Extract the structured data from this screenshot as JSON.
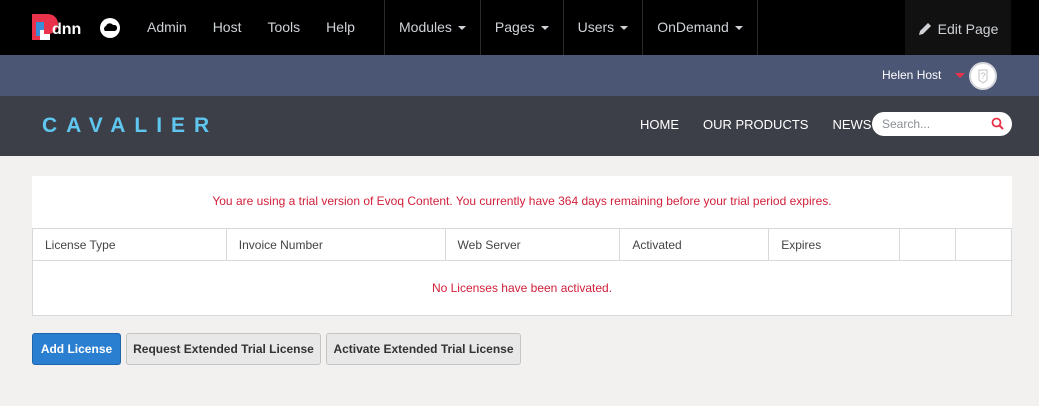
{
  "adminbar": {
    "logo_text": "dnn",
    "links": [
      "Admin",
      "Host",
      "Tools",
      "Help"
    ],
    "menus": [
      "Modules",
      "Pages",
      "Users",
      "OnDemand"
    ],
    "edit_page": "Edit Page"
  },
  "userbar": {
    "username": "Helen Host"
  },
  "site": {
    "brand": "CAVALIER",
    "nav": [
      "HOME",
      "OUR PRODUCTS",
      "NEWS"
    ],
    "search_placeholder": "Search..."
  },
  "license": {
    "trial_message": "You are using a trial version of Evoq Content. You currently have 364 days remaining before your trial period expires.",
    "columns": [
      "License Type",
      "Invoice Number",
      "Web Server",
      "Activated",
      "Expires",
      "",
      ""
    ],
    "empty_message": "No Licenses have been activated."
  },
  "buttons": {
    "add": "Add License",
    "request": "Request Extended Trial License",
    "activate": "Activate Extended Trial License"
  },
  "colors": {
    "accent_blue": "#2b7fd0",
    "alert_red": "#d1203b",
    "brand_cyan": "#5ec6ef"
  }
}
